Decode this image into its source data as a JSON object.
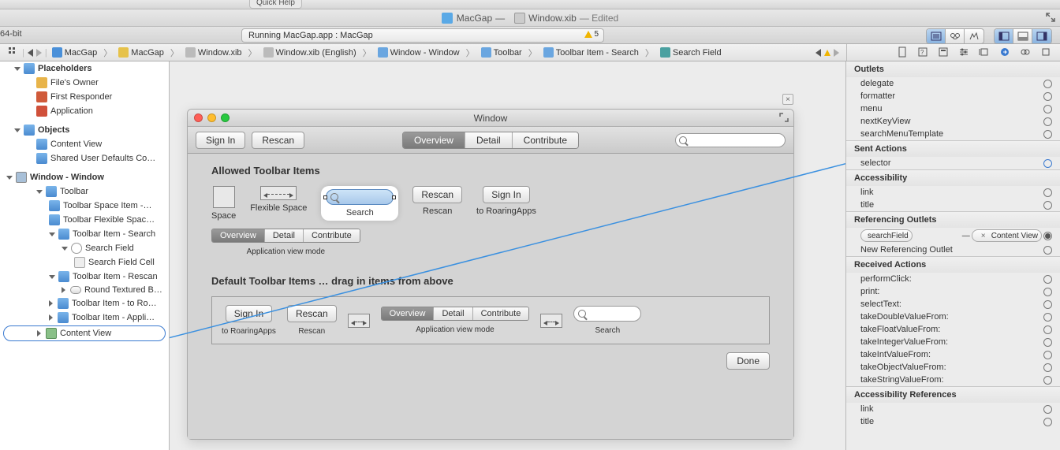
{
  "quick_help": "Quick Help",
  "title": {
    "project": "MacGap",
    "sep": "—",
    "file": "Window.xib",
    "edited": "— Edited"
  },
  "arch": "64-bit",
  "status": {
    "text": "Running MacGap.app : MacGap",
    "warn_count": "5"
  },
  "jump": {
    "items": [
      "MacGap",
      "MacGap",
      "Window.xib",
      "Window.xib (English)",
      "Window - Window",
      "Toolbar",
      "Toolbar Item - Search",
      "Search Field"
    ]
  },
  "outline": {
    "placeholders": "Placeholders",
    "files_owner": "File's Owner",
    "first_responder": "First Responder",
    "application": "Application",
    "objects": "Objects",
    "content_view": "Content View",
    "shared_defaults": "Shared User Defaults Co…",
    "window_window": "Window - Window",
    "toolbar": "Toolbar",
    "space_item": "Toolbar Space Item -…",
    "flex_item": "Toolbar Flexible Spac…",
    "item_search": "Toolbar Item - Search",
    "search_field": "Search Field",
    "search_field_cell": "Search Field Cell",
    "item_rescan": "Toolbar Item - Rescan",
    "round_button": "Round Textured B…",
    "item_roaring": "Toolbar Item - to Ro…",
    "item_appli": "Toolbar Item - Appli…",
    "content_view2": "Content View"
  },
  "ib": {
    "window_title": "Window",
    "sign_in": "Sign In",
    "rescan": "Rescan",
    "overview": "Overview",
    "detail": "Detail",
    "contribute": "Contribute",
    "allowed": "Allowed Toolbar Items",
    "space": "Space",
    "flex_space": "Flexible Space",
    "search": "Search",
    "rescan2": "Rescan",
    "sign_in2": "Sign In",
    "to_roaring": "to RoaringApps",
    "app_view_mode": "Application view mode",
    "default_title": "Default Toolbar Items … drag in items from above",
    "done": "Done"
  },
  "inspector": {
    "outlets": "Outlets",
    "outlets_items": [
      "delegate",
      "formatter",
      "menu",
      "nextKeyView",
      "searchMenuTemplate"
    ],
    "sent_actions": "Sent Actions",
    "selector": "selector",
    "accessibility": "Accessibility",
    "acc_items": [
      "link",
      "title"
    ],
    "ref_outlets": "Referencing Outlets",
    "search_field_ref": "searchField",
    "content_view_ref": "Content View",
    "new_ref": "New Referencing Outlet",
    "recv_actions": "Received Actions",
    "recv_items": [
      "performClick:",
      "print:",
      "selectText:",
      "takeDoubleValueFrom:",
      "takeFloatValueFrom:",
      "takeIntegerValueFrom:",
      "takeIntValueFrom:",
      "takeObjectValueFrom:",
      "takeStringValueFrom:"
    ],
    "acc_refs": "Accessibility References",
    "acc_refs_items": [
      "link",
      "title"
    ]
  }
}
